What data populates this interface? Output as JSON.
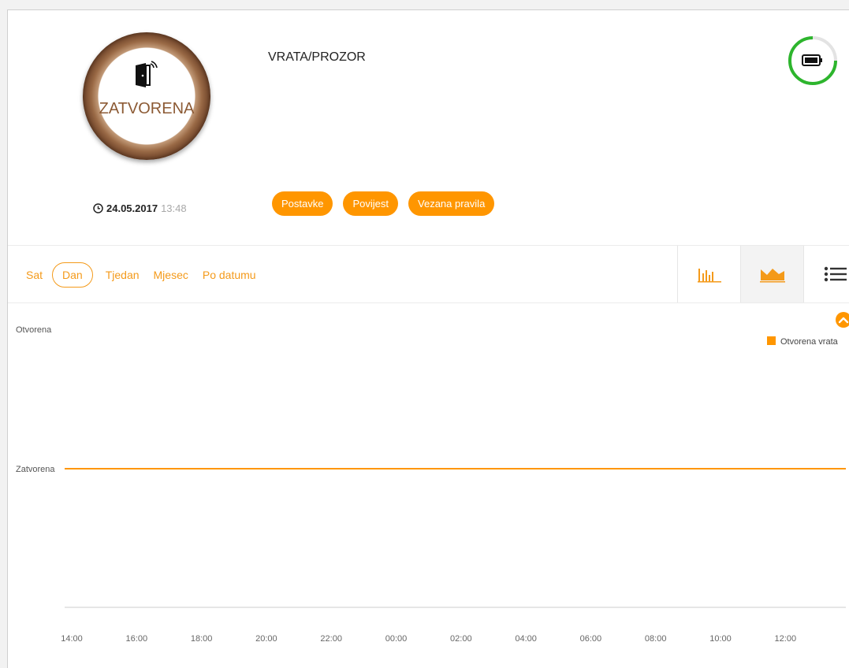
{
  "device": {
    "title": "VRATA/PROZOR",
    "status": "ZATVORENA",
    "date": "24.05.2017",
    "time": "13:48",
    "battery_ring_color": "#2db52d",
    "icons": {
      "device": "door-sensor-icon",
      "clock": "clock-icon",
      "battery": "battery-icon"
    }
  },
  "actions": {
    "settings": "Postavke",
    "history": "Povijest",
    "rules": "Vezana pravila"
  },
  "range_tabs": [
    "Sat",
    "Dan",
    "Tjedan",
    "Mjesec",
    "Po datumu"
  ],
  "active_range": "Dan",
  "view_buttons": [
    {
      "icon": "bar-chart-icon",
      "active": false
    },
    {
      "icon": "area-chart-icon",
      "active": true
    },
    {
      "icon": "list-icon",
      "active": false
    }
  ],
  "colors": {
    "accent": "#ff9600",
    "status_brown": "#8c5a34"
  },
  "chart_data": {
    "type": "line",
    "y_categories": [
      "Zatvorena",
      "Otvorena"
    ],
    "x_ticks": [
      "14:00",
      "16:00",
      "18:00",
      "20:00",
      "22:00",
      "00:00",
      "02:00",
      "04:00",
      "06:00",
      "08:00",
      "10:00",
      "12:00"
    ],
    "series": [
      {
        "name": "Otvorena vrata",
        "color": "#ff9600",
        "values": [
          "Zatvorena",
          "Zatvorena",
          "Zatvorena",
          "Zatvorena",
          "Zatvorena",
          "Zatvorena",
          "Zatvorena",
          "Zatvorena",
          "Zatvorena",
          "Zatvorena",
          "Zatvorena",
          "Zatvorena"
        ]
      }
    ],
    "legend_position": "top-right",
    "grid": false
  }
}
